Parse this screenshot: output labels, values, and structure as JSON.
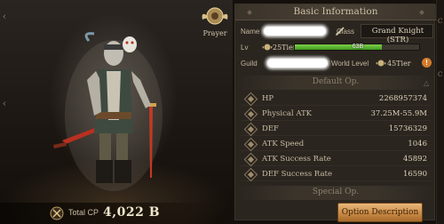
{
  "character": {
    "prayer_label": "Prayer",
    "total_cp_label": "Total CP",
    "total_cp_value": "4,022 B"
  },
  "basic_info": {
    "title": "Basic Information",
    "name_label": "Name",
    "class_label": "Class",
    "class_value": "Grand Knight (STR)",
    "lv_label": "Lv",
    "lv_tier": "25Tier",
    "exp_text": "63B",
    "exp_fill": 0.7,
    "guild_label": "Guild",
    "world_level_label": "World Level",
    "world_level_tier": "45Tier"
  },
  "default_op": {
    "title": "Default Op.",
    "stats": [
      {
        "name": "HP",
        "value": "2268957374"
      },
      {
        "name": "Physical ATK",
        "value": "37.25M-55.9M"
      },
      {
        "name": "DEF",
        "value": "15736329"
      },
      {
        "name": "ATK Speed",
        "value": "1046"
      },
      {
        "name": "ATK Success Rate",
        "value": "45892"
      },
      {
        "name": "DEF Success Rate",
        "value": "16590"
      }
    ]
  },
  "special_op": {
    "title": "Special Op."
  },
  "option_description_label": "Option Description",
  "colors": {
    "accent_orange": "#c98a44",
    "exp_green": "#5fb934",
    "panel_bg": "#2a251f"
  },
  "icons": {
    "prayer": "winged-emblem-icon",
    "cp": "crossed-swords-icon",
    "edit": "pencil-icon",
    "tier": "winged-badge-icon",
    "info": "info-icon"
  }
}
